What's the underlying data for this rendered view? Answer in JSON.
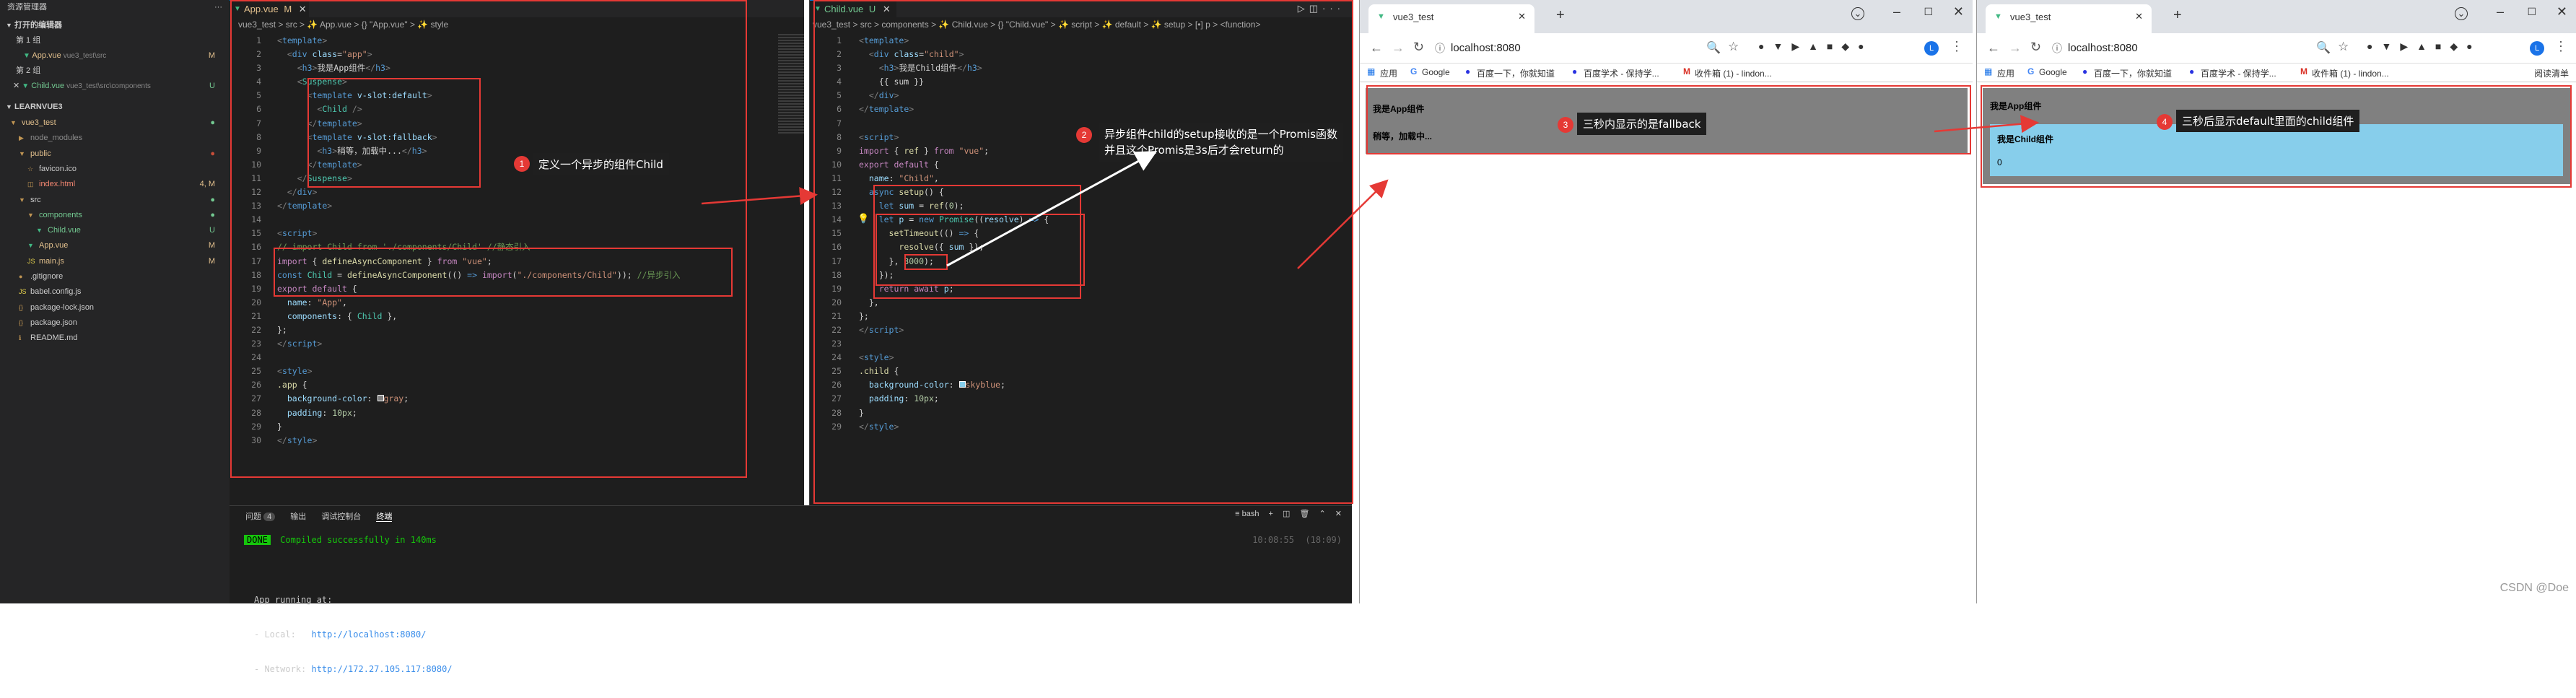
{
  "sidebar": {
    "title": "资源管理器",
    "open_editors": "打开的编辑器",
    "group1": "第 1 组",
    "group1_file": "App.vue",
    "group1_path": "vue3_test\\src",
    "group1_status": "M",
    "group2": "第 2 组",
    "group2_file": "Child.vue",
    "group2_path": "vue3_test\\src\\components",
    "group2_status": "U",
    "workspace": "LEARNVUE3",
    "tree": [
      {
        "label": "vue3_test",
        "indent": 0,
        "kind": "folder-open",
        "color": "#e2c08d",
        "status": "●",
        "status_color": "#73c991"
      },
      {
        "label": "node_modules",
        "indent": 1,
        "kind": "folder",
        "color": "#8c8c8c",
        "status": "",
        "status_color": "#888"
      },
      {
        "label": "public",
        "indent": 1,
        "kind": "folder-open",
        "color": "#e2c08d",
        "status": "●",
        "status_color": "#c74e39"
      },
      {
        "label": "favicon.ico",
        "indent": 2,
        "kind": "ico",
        "color": "#cccccc",
        "status": "",
        "status_color": "#888"
      },
      {
        "label": "index.html",
        "indent": 2,
        "kind": "html",
        "color": "#f48771",
        "status": "4, M",
        "status_color": "#e2c08d"
      },
      {
        "label": "src",
        "indent": 1,
        "kind": "folder-open",
        "color": "#cccccc",
        "status": "●",
        "status_color": "#73c991"
      },
      {
        "label": "components",
        "indent": 2,
        "kind": "folder-open",
        "color": "#73c991",
        "status": "●",
        "status_color": "#73c991"
      },
      {
        "label": "Child.vue",
        "indent": 3,
        "kind": "vue",
        "color": "#73c991",
        "status": "U",
        "status_color": "#73c991"
      },
      {
        "label": "App.vue",
        "indent": 2,
        "kind": "vue",
        "color": "#e2c08d",
        "status": "M",
        "status_color": "#e2c08d"
      },
      {
        "label": "main.js",
        "indent": 2,
        "kind": "js",
        "color": "#e2c08d",
        "status": "M",
        "status_color": "#e2c08d"
      },
      {
        "label": ".gitignore",
        "indent": 1,
        "kind": "git",
        "color": "#cccccc",
        "status": "",
        "status_color": "#888"
      },
      {
        "label": "babel.config.js",
        "indent": 1,
        "kind": "js",
        "color": "#cccccc",
        "status": "",
        "status_color": "#888"
      },
      {
        "label": "package-lock.json",
        "indent": 1,
        "kind": "json",
        "color": "#cccccc",
        "status": "",
        "status_color": "#888"
      },
      {
        "label": "package.json",
        "indent": 1,
        "kind": "json",
        "color": "#cccccc",
        "status": "",
        "status_color": "#888"
      },
      {
        "label": "README.md",
        "indent": 1,
        "kind": "md",
        "color": "#cccccc",
        "status": "",
        "status_color": "#888"
      }
    ]
  },
  "editor_left": {
    "tab": "App.vue",
    "tab_status": "M",
    "breadcrumb": "vue3_test > src > ✨ App.vue > {} \"App.vue\" > ✨ style",
    "lines": [
      "<p>1</p>",
      "2",
      "3",
      "4",
      "5",
      "6",
      "7",
      "8",
      "9",
      "10",
      "11",
      "12",
      "13",
      "14",
      "15",
      "16",
      "17",
      "18",
      "19",
      "20",
      "21",
      "22",
      "23",
      "24",
      "25",
      "26",
      "27",
      "28",
      "29",
      "30"
    ],
    "code": [
      "<span class=\"pu\">&lt;</span><span class=\"tg\">template</span><span class=\"pu\">&gt;</span>",
      "  <span class=\"pu\">&lt;</span><span class=\"tg\">div</span> <span class=\"at\">class</span>=<span class=\"st\">\"app\"</span><span class=\"pu\">&gt;</span>",
      "    <span class=\"pu\">&lt;</span><span class=\"tg\">h3</span><span class=\"pu\">&gt;</span>我是App组件<span class=\"pu\">&lt;/</span><span class=\"tg\">h3</span><span class=\"pu\">&gt;</span>",
      "    <span class=\"pu\">&lt;</span><span class=\"cl\">Suspense</span><span class=\"pu\">&gt;</span>",
      "      <span class=\"pu\">&lt;</span><span class=\"tg\">template</span> <span class=\"at\">v-slot:default</span><span class=\"pu\">&gt;</span>",
      "        <span class=\"pu\">&lt;</span><span class=\"cl\">Child</span> <span class=\"pu\">/&gt;</span>",
      "      <span class=\"pu\">&lt;/</span><span class=\"tg\">template</span><span class=\"pu\">&gt;</span>",
      "      <span class=\"pu\">&lt;</span><span class=\"tg\">template</span> <span class=\"at\">v-slot:fallback</span><span class=\"pu\">&gt;</span>",
      "        <span class=\"pu\">&lt;</span><span class=\"tg\">h3</span><span class=\"pu\">&gt;</span>稍等，加载中...<span class=\"pu\">&lt;/</span><span class=\"tg\">h3</span><span class=\"pu\">&gt;</span>",
      "      <span class=\"pu\">&lt;/</span><span class=\"tg\">template</span><span class=\"pu\">&gt;</span>",
      "    <span class=\"pu\">&lt;/</span><span class=\"cl\">Suspense</span><span class=\"pu\">&gt;</span>",
      "  <span class=\"pu\">&lt;/</span><span class=\"tg\">div</span><span class=\"pu\">&gt;</span>",
      "<span class=\"pu\">&lt;/</span><span class=\"tg\">template</span><span class=\"pu\">&gt;</span>",
      "",
      "<span class=\"pu\">&lt;</span><span class=\"tg\">script</span><span class=\"pu\">&gt;</span>",
      "<span class=\"cm\">// import Child from './components/Child' //静态引入</span>",
      "<span class=\"kw\">import</span> { <span class=\"fn\">defineAsyncComponent</span> } <span class=\"kw\">from</span> <span class=\"st\">\"vue\"</span>;",
      "<span class=\"tg\">const</span> <span class=\"cl\">Child</span> = <span class=\"fn\">defineAsyncComponent</span>(() <span class=\"tg\">=&gt;</span> <span class=\"kw\">import</span>(<span class=\"st\">\"./components/Child\"</span>)); <span class=\"cm\">//异步引入</span>",
      "<span class=\"kw\">export default</span> {",
      "  <span class=\"at\">name</span>: <span class=\"st\">\"App\"</span>,",
      "  <span class=\"at\">components</span>: { <span class=\"cl\">Child</span> },",
      "};",
      "<span class=\"pu\">&lt;/</span><span class=\"tg\">script</span><span class=\"pu\">&gt;</span>",
      "",
      "<span class=\"pu\">&lt;</span><span class=\"tg\">style</span><span class=\"pu\">&gt;</span>",
      "<span class=\"fn\">.app</span> {",
      "  <span class=\"at\">background-color</span>: <span style=\"display:inline-block;width:9px;height:9px;background:gray;border:1px solid #fff\"></span><span class=\"st\">gray</span>;",
      "  <span class=\"at\">padding</span>: <span class=\"nm\">10px</span>;",
      "}",
      "<span class=\"pu\">&lt;/</span><span class=\"tg\">style</span><span class=\"pu\">&gt;</span>"
    ]
  },
  "editor_right": {
    "tab": "Child.vue",
    "tab_status": "U",
    "breadcrumb": "vue3_test > src > components > ✨ Child.vue > {} \"Child.vue\" > ✨ script > ✨ default > ✨ setup > [•] p > <function>",
    "code": [
      "<span class=\"pu\">&lt;</span><span class=\"tg\">template</span><span class=\"pu\">&gt;</span>",
      "  <span class=\"pu\">&lt;</span><span class=\"tg\">div</span> <span class=\"at\">class</span>=<span class=\"st\">\"child\"</span><span class=\"pu\">&gt;</span>",
      "    <span class=\"pu\">&lt;</span><span class=\"tg\">h3</span><span class=\"pu\">&gt;</span>我是Child组件<span class=\"pu\">&lt;/</span><span class=\"tg\">h3</span><span class=\"pu\">&gt;</span>",
      "    {{ sum }}",
      "  <span class=\"pu\">&lt;/</span><span class=\"tg\">div</span><span class=\"pu\">&gt;</span>",
      "<span class=\"pu\">&lt;/</span><span class=\"tg\">template</span><span class=\"pu\">&gt;</span>",
      "",
      "<span class=\"pu\">&lt;</span><span class=\"tg\">script</span><span class=\"pu\">&gt;</span>",
      "<span class=\"kw\">import</span> { <span class=\"fn\">ref</span> } <span class=\"kw\">from</span> <span class=\"st\">\"vue\"</span>;",
      "<span class=\"kw\">export default</span> {",
      "  <span class=\"at\">name</span>: <span class=\"st\">\"Child\"</span>,",
      "  <span class=\"tg\">async</span> <span class=\"fn\">setup</span>() {",
      "    <span class=\"tg\">let</span> <span class=\"at\">sum</span> = <span class=\"fn\">ref</span>(<span class=\"nm\">0</span>);",
      "    <span class=\"tg\">let</span> <span class=\"at\">p</span> = <span class=\"tg\">new</span> <span class=\"cl\">Promise</span>((<span class=\"at\">resolve</span>) <span class=\"tg\">=&gt;</span> {",
      "      <span class=\"fn\">setTimeout</span>(() <span class=\"tg\">=&gt;</span> {",
      "        <span class=\"fn\">resolve</span>({ <span class=\"at\">sum</span> });",
      "      }, <span class=\"nm\">3000</span>);",
      "    });",
      "    <span class=\"kw\">return</span> <span class=\"kw\">await</span> <span class=\"at\">p</span>;",
      "  },",
      "};",
      "<span class=\"pu\">&lt;/</span><span class=\"tg\">script</span><span class=\"pu\">&gt;</span>",
      "",
      "<span class=\"pu\">&lt;</span><span class=\"tg\">style</span><span class=\"pu\">&gt;</span>",
      "<span class=\"fn\">.child</span> {",
      "  <span class=\"at\">background-color</span>: <span style=\"display:inline-block;width:9px;height:9px;background:skyblue;border:1px solid #fff\"></span><span class=\"st\">skyblue</span>;",
      "  <span class=\"at\">padding</span>: <span class=\"nm\">10px</span>;",
      "}",
      "<span class=\"pu\">&lt;/</span><span class=\"tg\">style</span><span class=\"pu\">&gt;</span>"
    ]
  },
  "terminal": {
    "tabs": [
      "问题",
      "输出",
      "调试控制台",
      "终端"
    ],
    "problems_count": "4",
    "shell": "bash",
    "done_badge": "DONE",
    "compiled_msg": "Compiled successfully in 140ms",
    "time": "10:08:55",
    "shell_right": "(18:09)",
    "running": "App running at:",
    "local_label": "- Local:",
    "local_url": "http://localhost:8080/",
    "network_label": "- Network:",
    "network_url": "http://172.27.105.117:8080/"
  },
  "browser1": {
    "tab_title": "vue3_test",
    "url": "localhost:8080",
    "bookmarks": [
      "应用",
      "Google",
      "百度一下，你就知道",
      "百度学术 - 保持学...",
      "收件箱 (1) - lindon..."
    ],
    "app_title": "我是App组件",
    "fallback_text": "稍等，加载中..."
  },
  "browser2": {
    "tab_title": "vue3_test",
    "url": "localhost:8080",
    "bookmarks": [
      "应用",
      "Google",
      "百度一下，你就知道",
      "百度学术 - 保持学...",
      "收件箱 (1) - lindon..."
    ],
    "reading_list": "阅读清单",
    "app_title": "我是App组件",
    "child_title": "我是Child组件",
    "child_sum": "0"
  },
  "annotations": {
    "n1": "1",
    "t1": "定义一个异步的组件Child",
    "n2": "2",
    "t2a": "异步组件child的setup接收的是一个Promis函数",
    "t2b": "并且这个Promis是3s后才会return的",
    "n3": "3",
    "t3": "三秒内显示的是fallback",
    "n4": "4",
    "t4": "三秒后显示default里面的child组件"
  },
  "watermark": "CSDN @Doe",
  "colors": {
    "red": "#e53935",
    "skyblue": "#87ceeb",
    "gray": "#808080"
  }
}
